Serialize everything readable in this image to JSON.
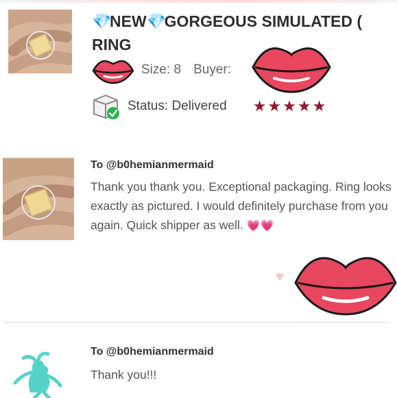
{
  "listing": {
    "gem_left": "💎",
    "title_new": "NEW",
    "gem_right": "💎",
    "title_rest": "GORGEOUS SIMULATED",
    "title_cut": "(",
    "title_line2": "RING",
    "size_label": "Size: 8",
    "buyer_label": "Buyer:",
    "status_label": "Status:",
    "status_value": "Delivered",
    "rating": 5,
    "stars": "★★★★★",
    "star_color": "#8b1a2e"
  },
  "reviews": [
    {
      "to": "To @b0hemianmermaid",
      "text": "Thank you thank you. Exceptional packaging. Ring looks exactly as pictured. I would definitely purchase from you again. Quick shipper as well.",
      "hearts": "💗💗",
      "like_icon": "heart-icon"
    },
    {
      "to": "To @b0hemianmermaid",
      "text": "Thank you!!!"
    }
  ],
  "colors": {
    "lips": "#e8475f",
    "lips_dark": "#c02a45",
    "heart_like": "#f6c5cb",
    "check_green": "#2bb34a"
  }
}
